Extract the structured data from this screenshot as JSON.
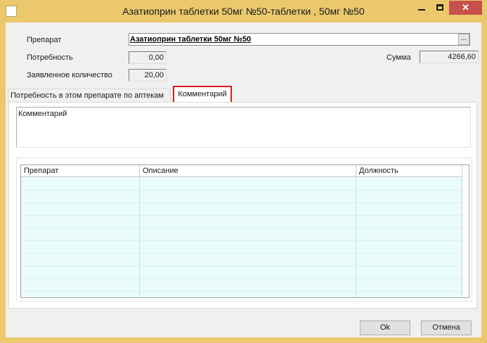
{
  "window": {
    "title": "Азатиоприн таблетки  50мг №50-таблетки , 50мг №50",
    "min_icon": "minimize-icon",
    "max_icon": "maximize-icon",
    "close_icon": "close-icon",
    "close_glyph": "✕"
  },
  "form": {
    "drug_label": "Препарат",
    "drug_value": "Азатиоприн таблетки  50мг №50",
    "browse_label": "...",
    "need_label": "Потребность",
    "need_value": "0,00",
    "declared_label": "Заявленное количество",
    "declared_value": "20,00",
    "sum_label": "Сумма",
    "sum_value": "4266,60"
  },
  "tabs": [
    {
      "label": "Потребность в этом препарате по аптекам",
      "active": false
    },
    {
      "label": "Комментарий",
      "active": true
    }
  ],
  "comment": {
    "text": "Комментарий"
  },
  "table": {
    "columns": [
      "Препарат",
      "Описание",
      "Должность"
    ],
    "rows": []
  },
  "buttons": {
    "ok": "Ok",
    "cancel": "Отмена"
  },
  "colors": {
    "title_bar": "#ebc86c",
    "close_button": "#c7504d",
    "highlight": "#d91f1f",
    "grid_bg": "#e9fbfb"
  }
}
